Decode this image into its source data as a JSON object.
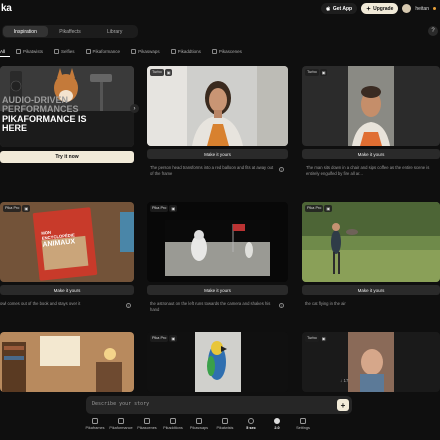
{
  "app": {
    "logo": "ka"
  },
  "header": {
    "get_app": "Get App",
    "upgrade": "Upgrade",
    "username": "heitan"
  },
  "main_tabs": [
    {
      "label": "Inspiration",
      "active": true
    },
    {
      "label": "Pikaffects",
      "active": false
    },
    {
      "label": "Library",
      "active": false
    }
  ],
  "filters": [
    {
      "label": "All",
      "active": true
    },
    {
      "label": "Pikatwists",
      "active": false
    },
    {
      "label": "Selfies",
      "active": false
    },
    {
      "label": "Pikaformance",
      "active": false
    },
    {
      "label": "Pikaswaps",
      "active": false
    },
    {
      "label": "Pikaddtions",
      "active": false
    },
    {
      "label": "Pikascenes",
      "active": false
    }
  ],
  "hero": {
    "line1": "AUDIO-DRIVEN",
    "line2": "PERFORMANCES",
    "line3": "PIKAFORMANCE IS",
    "line4": "HERE",
    "button": "Try it now"
  },
  "cards": [
    {
      "badge1": "Turbo",
      "button": "Make it yours",
      "caption": "The person head transforms into a red balloon and fits at away out of the frame"
    },
    {
      "badge1": "Turbo",
      "button": "Make it yours",
      "caption": "The man sits down in a chair and sips coffee as the entire scene is entirely engulfed by fire all ar..."
    },
    {
      "badge1": "Pika Pro",
      "button": "Make it yours",
      "caption": "owl comes out of the book and stays over it"
    },
    {
      "badge1": "Pika Pro",
      "button": "Make it yours",
      "caption": "the astronaut on the left runs towards the camera and shakes his hand"
    },
    {
      "badge1": "Pika Pro",
      "button": "Make it yours",
      "caption": "the cat flying in the air"
    },
    {
      "badge1": "Pika Pro"
    },
    {
      "badge1": "Turbo"
    }
  ],
  "book": {
    "title_line1": "MON",
    "title_line2": "ENCYCLOPÉDIE",
    "title_line3": "ANIMAUX"
  },
  "prompt": {
    "placeholder": "Describe your story",
    "send": "+"
  },
  "scroll_hint": "↓ 17",
  "toolbar": [
    {
      "label": "Pikaframes",
      "icon": "frames-icon"
    },
    {
      "label": "Pikaformance",
      "icon": "performance-icon"
    },
    {
      "label": "Pikascenes",
      "icon": "scenes-icon"
    },
    {
      "label": "Pikaddtions",
      "icon": "additions-icon"
    },
    {
      "label": "Pikaswaps",
      "icon": "swaps-icon"
    },
    {
      "label": "Pikatwists",
      "icon": "twists-icon"
    },
    {
      "label": "5 sec",
      "icon": "clock-icon"
    },
    {
      "label": "2.0",
      "icon": "cloud-icon"
    },
    {
      "label": "Settings",
      "icon": "settings-icon"
    }
  ],
  "colors": {
    "accent": "#f1ead8",
    "background": "#0f0f0f",
    "panel": "#1c1c1c"
  }
}
